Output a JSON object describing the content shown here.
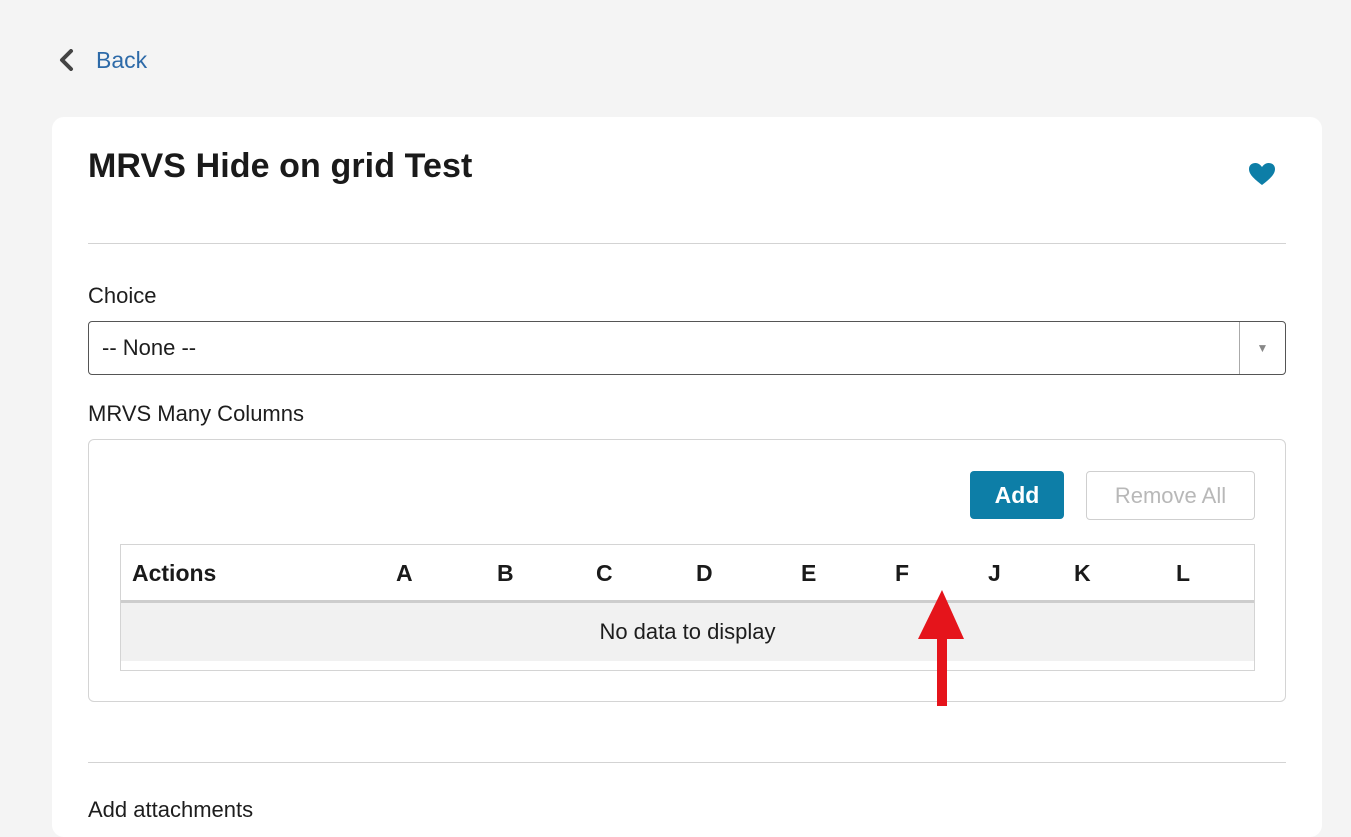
{
  "nav": {
    "back_label": "Back"
  },
  "item": {
    "title": "MRVS Hide on grid Test"
  },
  "choice": {
    "label": "Choice",
    "value": "-- None --"
  },
  "mrvs": {
    "label": "MRVS Many Columns",
    "add_label": "Add",
    "remove_all_label": "Remove All",
    "columns": [
      "Actions",
      "A",
      "B",
      "C",
      "D",
      "E",
      "F",
      "J",
      "K",
      "L"
    ],
    "empty_message": "No data to display"
  },
  "attachments": {
    "label": "Add attachments"
  },
  "colors": {
    "accent": "#0d7ea7",
    "link": "#2d6aa8",
    "annotation_arrow": "#e5141b"
  },
  "icons": {
    "back": "chevron-left-icon",
    "favorite": "heart-icon",
    "dropdown": "caret-down-icon"
  }
}
